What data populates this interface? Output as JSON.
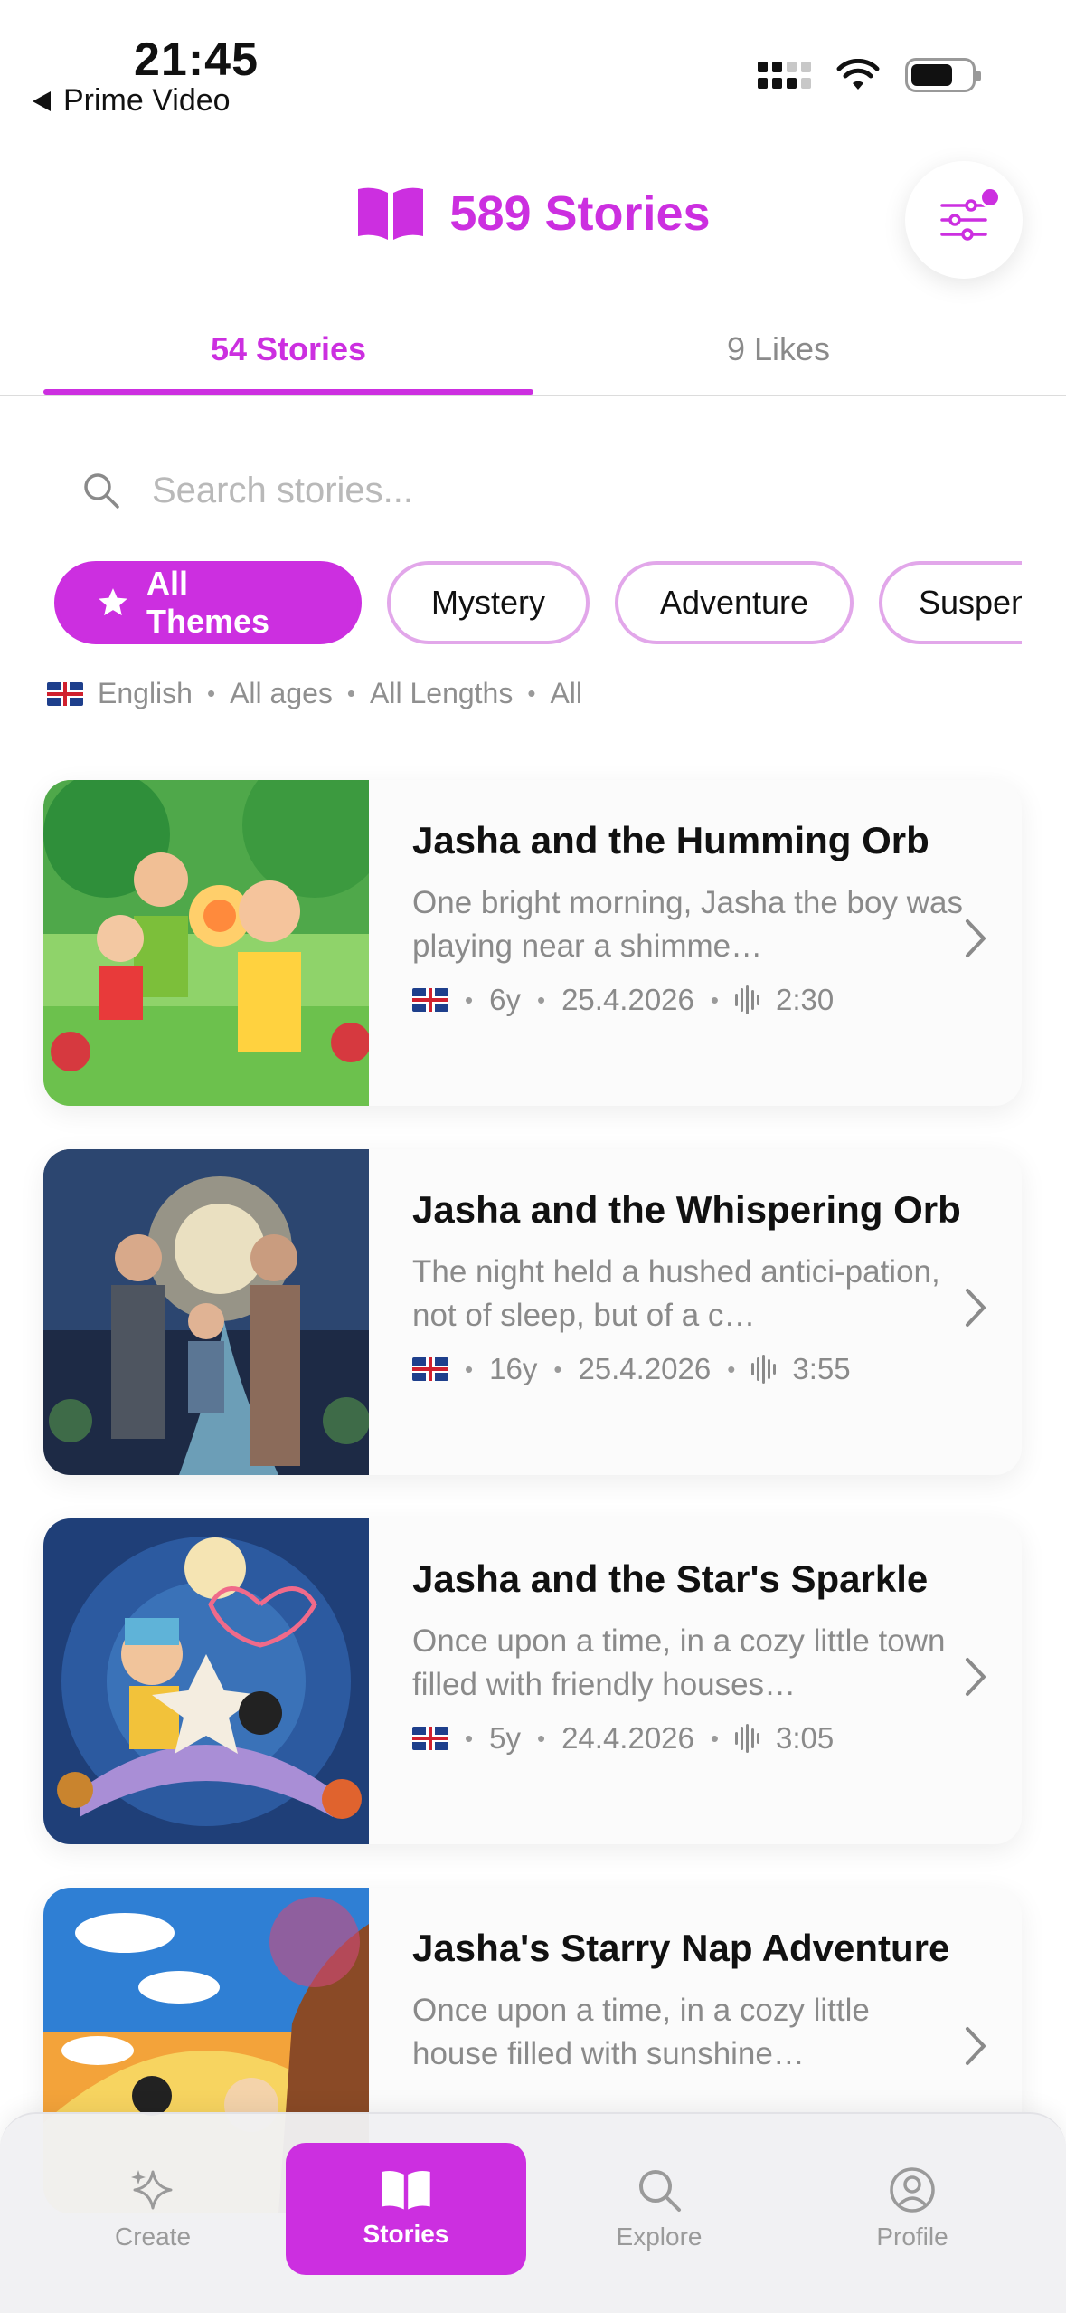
{
  "status": {
    "time": "21:45",
    "back_app": "Prime Video"
  },
  "header": {
    "title": "589 Stories",
    "book_icon": "book-open-icon",
    "filter_icon": "sliders-icon"
  },
  "tabs": [
    {
      "label": "54 Stories",
      "active": true
    },
    {
      "label": "9 Likes",
      "active": false
    }
  ],
  "search": {
    "placeholder": "Search stories...",
    "value": ""
  },
  "themes": [
    {
      "label": "All Themes",
      "active": true,
      "icon": "star-icon"
    },
    {
      "label": "Mystery",
      "active": false
    },
    {
      "label": "Adventure",
      "active": false
    },
    {
      "label": "Suspense",
      "active": false
    }
  ],
  "filter_summary": {
    "language": "English",
    "ages": "All ages",
    "lengths": "All Lengths",
    "other": "All"
  },
  "stories": [
    {
      "title": "Jasha and the Humming Orb",
      "description": "One bright morning, Jasha the boy was playing near a shimme…",
      "age": "6y",
      "date": "25.4.2026",
      "duration": "2:30"
    },
    {
      "title": "Jasha and the Whispering Orb",
      "description": "The night held a hushed antici-pation, not of sleep, but of a c…",
      "age": "16y",
      "date": "25.4.2026",
      "duration": "3:55"
    },
    {
      "title": "Jasha and the Star's Sparkle",
      "description": "Once upon a time, in a cozy little town filled with friendly houses…",
      "age": "5y",
      "date": "24.4.2026",
      "duration": "3:05"
    },
    {
      "title": "Jasha's Starry Nap Adventure",
      "description": "Once upon a time, in a cozy little house filled with sunshine…",
      "age": "",
      "date": "",
      "duration": ""
    }
  ],
  "nav": [
    {
      "label": "Create",
      "icon": "sparkle-icon",
      "active": false
    },
    {
      "label": "Stories",
      "icon": "book-open-icon",
      "active": true
    },
    {
      "label": "Explore",
      "icon": "search-icon",
      "active": false
    },
    {
      "label": "Profile",
      "icon": "person-circle-icon",
      "active": false
    }
  ],
  "colors": {
    "accent": "#cc2fe0",
    "muted_text": "#8a8a8a"
  }
}
